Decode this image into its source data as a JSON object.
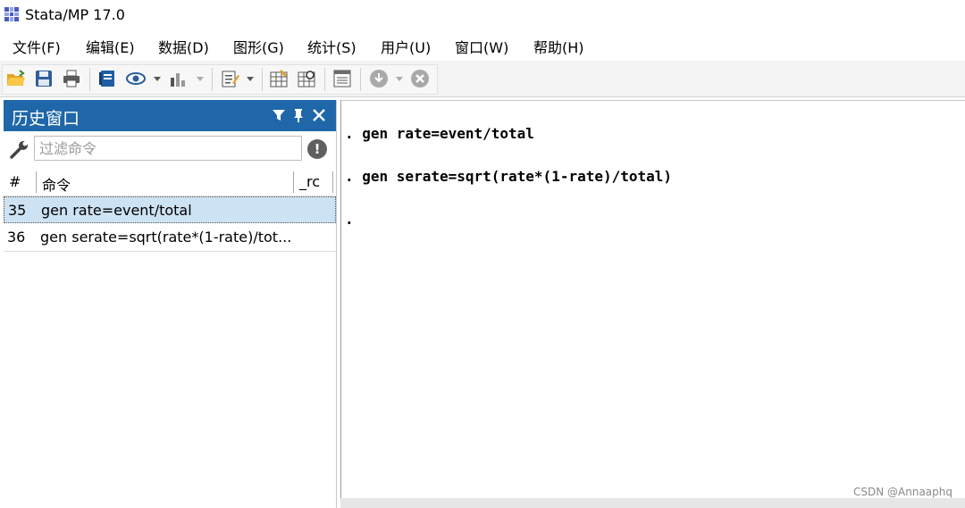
{
  "window": {
    "title": "Stata/MP 17.0"
  },
  "menu": {
    "items": [
      "文件(F)",
      "编辑(E)",
      "数据(D)",
      "图形(G)",
      "统计(S)",
      "用户(U)",
      "窗口(W)",
      "帮助(H)"
    ]
  },
  "toolbar": {
    "icons": [
      "open-folder-icon",
      "save-icon",
      "print-icon",
      "log-icon",
      "viewer-icon",
      "graph-icon",
      "do-file-editor-icon",
      "data-editor-icon",
      "data-browser-icon",
      "variables-manager-icon",
      "more-icon",
      "break-icon"
    ]
  },
  "history": {
    "title": "历史窗口",
    "filter_placeholder": "过滤命令",
    "columns": {
      "num": "#",
      "command": "命令",
      "rc": "_rc"
    },
    "rows": [
      {
        "num": "35",
        "command": "gen rate=event/total",
        "selected": true
      },
      {
        "num": "36",
        "command": "gen serate=sqrt(rate*(1-rate)/tot...",
        "selected": false
      }
    ]
  },
  "results": {
    "lines": [
      ". gen rate=event/total",
      ". gen serate=sqrt(rate*(1-rate)/total)",
      "."
    ]
  },
  "watermark": "CSDN @Annaaphq",
  "colors": {
    "panel_header": "#1f67a8",
    "selected_row": "#cde2f3"
  }
}
